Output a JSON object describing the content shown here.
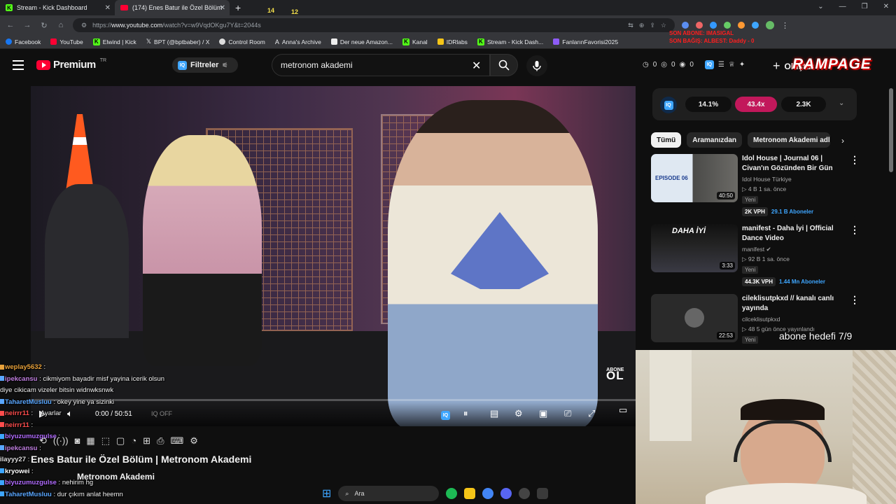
{
  "browser": {
    "tabs": [
      {
        "label": "Stream - Kick Dashboard",
        "icon": "kick-icon"
      },
      {
        "label": "(174) Enes Batur ile Özel Bölüm",
        "icon": "youtube-icon"
      }
    ],
    "new_tab": "+",
    "url_prefix": "https://",
    "url_domain": "www.youtube.com",
    "url_path": "/watch?v=w9VqdOKgu7Y&t=2044s",
    "bookmarks": [
      "Facebook",
      "YouTube",
      "Elwind | Kick",
      "BPT (@bptbaber) / X",
      "Control Room",
      "Anna's Archive",
      "Der neue Amazon...",
      "Kanal",
      "IDRlabs",
      "Stream - Kick Dash...",
      "FanlarınFavorisi2025"
    ],
    "overlay_emotes": [
      "14",
      "12"
    ]
  },
  "youtube": {
    "logo_text": "Premium",
    "logo_region": "TR",
    "filters_label": "Filtreler",
    "search_value": "metronom akademi",
    "header_stats": [
      "0",
      "0",
      "0"
    ],
    "create_label": "Oluştur",
    "overlay_brand": "RAMPAGE",
    "sub_goal_lines": [
      "SON ABONE: IMASIGAL",
      "SON BAĞIŞ: ALBEST: Daddy - 0"
    ]
  },
  "player": {
    "time": "0:00 / 50:51",
    "iq_label": "IQ",
    "off_label": "OFF",
    "overlay_abone_small": "ABONE",
    "overlay_abone_big": "OL",
    "ayarlar_label": "Ayarlar"
  },
  "video_info": {
    "title": "Enes Batur ile Özel Bölüm | Metronom Akademi",
    "channel": "Metronom Akademi"
  },
  "chat": [
    {
      "user": "weplay5632",
      "msg": ":",
      "color": "#e9a23b"
    },
    {
      "user": "ipekcansu",
      "msg": ": cikmiyom bayadir misf yayina icerik olsun",
      "color": "#c07fe0"
    },
    {
      "user": "",
      "msg": "diye cikicam vizeler bitsin widnwksnwk",
      "color": "#fff"
    },
    {
      "user": "TaharetMusluu",
      "msg": ": okey yine ya sizinki",
      "color": "#5aa7ff"
    },
    {
      "user": "neirrr11",
      "msg": ":",
      "color": "#ff4d4d"
    },
    {
      "user": "neirrr11",
      "msg": ":",
      "color": "#ff4d4d"
    },
    {
      "user": "biyuzumuzgulse",
      "msg": ":",
      "color": "#b26cff"
    },
    {
      "user": "ipekcansu",
      "msg": ":",
      "color": "#c07fe0"
    },
    {
      "user": "ilayyy27",
      "msg": ":",
      "color": "#ddd"
    },
    {
      "user": "kryowei",
      "msg": ":",
      "color": "#fff"
    },
    {
      "user": "biyuzumuzgulse",
      "msg": ": nehirim hg",
      "color": "#b26cff"
    },
    {
      "user": "TaharetMusluu",
      "msg": ": dur çıkım anlat heemn",
      "color": "#5aa7ff"
    }
  ],
  "sidebar": {
    "iq_stats": [
      "14.1%",
      "43.4x",
      "2.3K"
    ],
    "chips": [
      "Tümü",
      "Aramanızdan",
      "Metronom Akademi adlı"
    ],
    "recs": [
      {
        "title": "Idol House | Journal 06 | Civan'ın Gözünden Bir Gün",
        "channel": "Idol House Türkiye",
        "meta": "4 B  1 sa. önce",
        "duration": "40:50",
        "badge": "Yeni",
        "vph": "2K VPH",
        "subs": "29.1 B Aboneler",
        "thumb_text": "EPISODE 06"
      },
      {
        "title": "manifest - Daha İyi | Official Dance Video",
        "channel": "manifest",
        "meta": "92 B  1 sa. önce",
        "duration": "3:33",
        "badge": "Yeni",
        "vph": "44.3K VPH",
        "subs": "1.44 Mn Aboneler",
        "thumb_text": "DAHA İYİ"
      },
      {
        "title": "cileklisutpkxd // kanalı canlı yayında",
        "channel": "cilceklisutpkxd",
        "meta": "48  5 gün önce yayınlandı",
        "duration": "22:53",
        "badge": "Yeni",
        "vph": "",
        "subs": "",
        "thumb_text": ""
      }
    ]
  },
  "stream_overlay": {
    "abone_hedefi": "abone hedefi 7/9"
  },
  "taskbar": {
    "search_placeholder": "Ara"
  },
  "colors": {
    "youtube_red": "#ff0033",
    "kick_green": "#53fc18",
    "accent_blue": "#3ea6ff",
    "pill_pink": "#c2185b"
  }
}
